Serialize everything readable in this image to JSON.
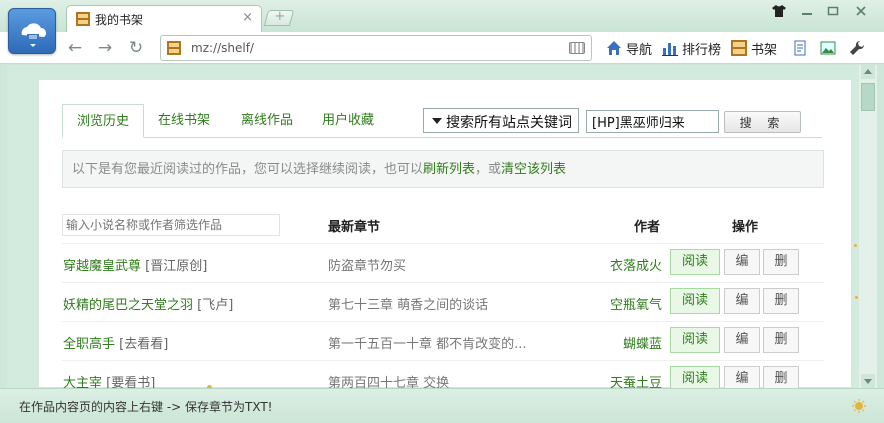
{
  "browser": {
    "tab_title": "我的书架",
    "tab_close": "×",
    "new_tab": "+",
    "address": "mz://shelf/",
    "toolbar_items": [
      {
        "label": "导航",
        "icon": "home-icon"
      },
      {
        "label": "排行榜",
        "icon": "bar-chart-icon"
      },
      {
        "label": "书架",
        "icon": "bookshelf-icon"
      }
    ],
    "window_controls": [
      "shirt-icon",
      "minimize-icon",
      "restore-icon",
      "close-icon"
    ]
  },
  "shelf": {
    "tabs": [
      "浏览历史",
      "在线书架",
      "离线作品",
      "用户收藏"
    ],
    "active_tab": 0,
    "search_scope": "搜索所有站点关键词",
    "search_keyword": "[HP]黑巫师归来",
    "search_button": "搜 索",
    "notice_text": "以下是有您最近阅读过的作品，您可以选择继续阅读，也可以",
    "notice_link1": "刷新列表",
    "notice_mid": "，或",
    "notice_link2": "清空该列表",
    "filter_placeholder": "输入小说名称或作者筛选作品",
    "col_chapter": "最新章节",
    "col_author": "作者",
    "col_action": "操作",
    "rows": [
      {
        "title": "穿越魔皇武尊",
        "site": " [晋江原创]",
        "chapter": "防盗章节勿买",
        "author": "衣落成火",
        "read": "阅读",
        "edit": "编",
        "del": "删"
      },
      {
        "title": "妖精的尾巴之天堂之羽",
        "site": " [飞卢]",
        "chapter": "第七十三章 萌香之间的谈话",
        "author": "空瓶氧气",
        "read": "阅读",
        "edit": "编",
        "del": "删"
      },
      {
        "title": "全职高手",
        "site": " [去看看]",
        "chapter": "第一千五百一十章 都不肯改变的...",
        "author": "蝴蝶蓝",
        "read": "阅读",
        "edit": "编",
        "del": "删"
      },
      {
        "title": "大主宰",
        "site": " [要看书]",
        "chapter": "第两百四十七章 交换",
        "author": "天蚕土豆",
        "read": "阅读",
        "edit": "编",
        "del": "删"
      }
    ]
  },
  "status_bar": "在作品内容页的内容上右键 -> 保存章节为TXT!",
  "colors": {
    "green_text": "#2f7c1c",
    "chrome": "#cfe6da"
  }
}
